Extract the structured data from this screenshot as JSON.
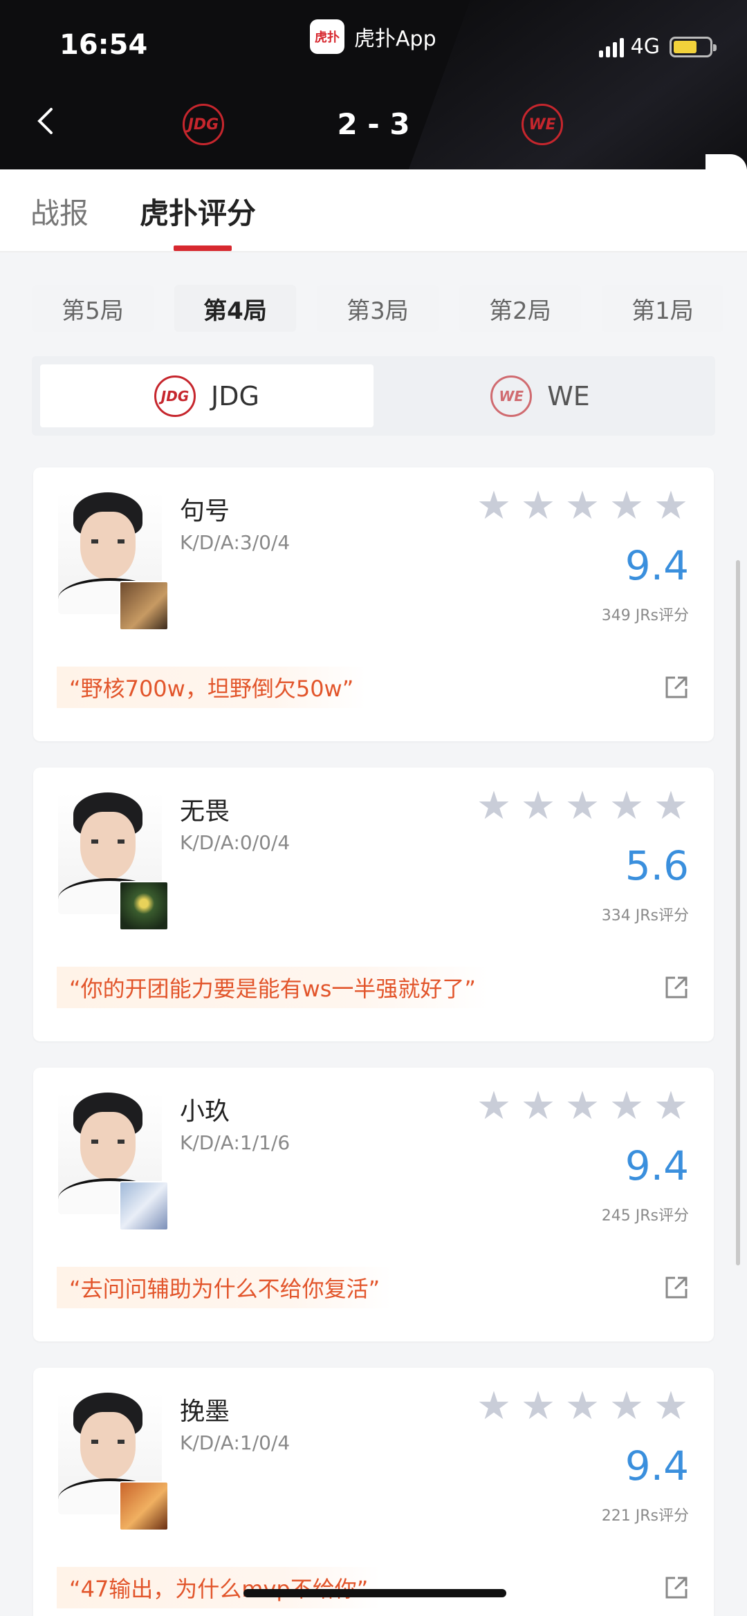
{
  "status_bar": {
    "time": "16:54",
    "app_name": "虎扑App",
    "app_logo_char": "虎扑",
    "network": "4G"
  },
  "match": {
    "home_team": "JDG",
    "away_team": "WE",
    "score": "2 - 3",
    "home_logo_text": "JDG",
    "away_logo_text": "WE"
  },
  "tabs": [
    {
      "label": "战报"
    },
    {
      "label": "虎扑评分"
    }
  ],
  "games": [
    {
      "label": "第5局"
    },
    {
      "label": "第4局"
    },
    {
      "label": "第3局"
    },
    {
      "label": "第2局"
    },
    {
      "label": "第1局"
    }
  ],
  "selected_game": "第4局",
  "team_switch": [
    {
      "label": "JDG",
      "logo_text": "JDG"
    },
    {
      "label": "WE",
      "logo_text": "WE"
    }
  ],
  "players": [
    {
      "name": "句号",
      "kda": "K/D/A:3/0/4",
      "score": "9.4",
      "votes": "349 JRs评分",
      "comment": "“野核700w，坦野倒欠50w”"
    },
    {
      "name": "无畏",
      "kda": "K/D/A:0/0/4",
      "score": "5.6",
      "votes": "334 JRs评分",
      "comment": "“你的开团能力要是能有ws一半强就好了”"
    },
    {
      "name": "小玖",
      "kda": "K/D/A:1/1/6",
      "score": "9.4",
      "votes": "245 JRs评分",
      "comment": "“去问问辅助为什么不给你复活”"
    },
    {
      "name": "挽墨",
      "kda": "K/D/A:1/0/4",
      "score": "9.4",
      "votes": "221 JRs评分",
      "comment": "“47输出，为什么mvp不给你”"
    }
  ],
  "colors": {
    "accent": "#d7282f",
    "score_blue": "#3a8fdd",
    "comment_orange": "#e2552b"
  },
  "icons": {
    "back": "chevron-left-icon",
    "share": "share-icon",
    "star": "star-icon"
  }
}
